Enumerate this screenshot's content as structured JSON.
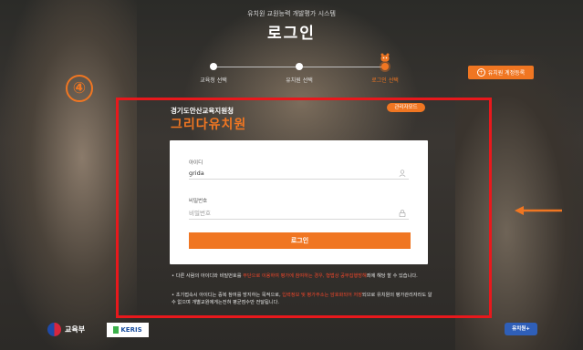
{
  "header": {
    "system_title": "유치원 교원능력 개발평가 시스템",
    "page_title": "로그인"
  },
  "stepper": {
    "steps": [
      {
        "label": "교육청 선택",
        "active": false
      },
      {
        "label": "유치원 선택",
        "active": false
      },
      {
        "label": "로그인 선택",
        "active": true
      }
    ]
  },
  "register_button": {
    "label": "유치원 계정등록"
  },
  "annotation": {
    "step_number": "④"
  },
  "institution": {
    "office": "경기도안산교육지원청",
    "name": "그리다유치원",
    "mode_badge": "관리자모드"
  },
  "login_form": {
    "id_label": "아이디",
    "id_value": "grida",
    "password_label": "비밀번호",
    "password_placeholder": "비밀번호",
    "submit_label": "로그인"
  },
  "notices": [
    {
      "pre": "• 다른 사람의 아이디와 비밀번호를 ",
      "red": "무단으로 이용하여 평가에 참여하는 경우, 형법상 공무집행방해",
      "post": "죄에 해당 할 수 있습니다."
    },
    {
      "pre": "• 초기접속시 아이디는 중복 참여를 방지하는 목적으로, ",
      "red": "입력정보 및 평가주소는 암호화되어 저장",
      "post": "되므로 유치원의 평가관리자라도 알 수 없으며 개별교원에게는전혀 평균점수만 전달됩니다."
    }
  ],
  "footer": {
    "moe_label": "교육부",
    "keris_label": "KERIS",
    "right_logo": "유치원+"
  },
  "colors": {
    "accent": "#f07622",
    "highlight": "#e8181c"
  }
}
